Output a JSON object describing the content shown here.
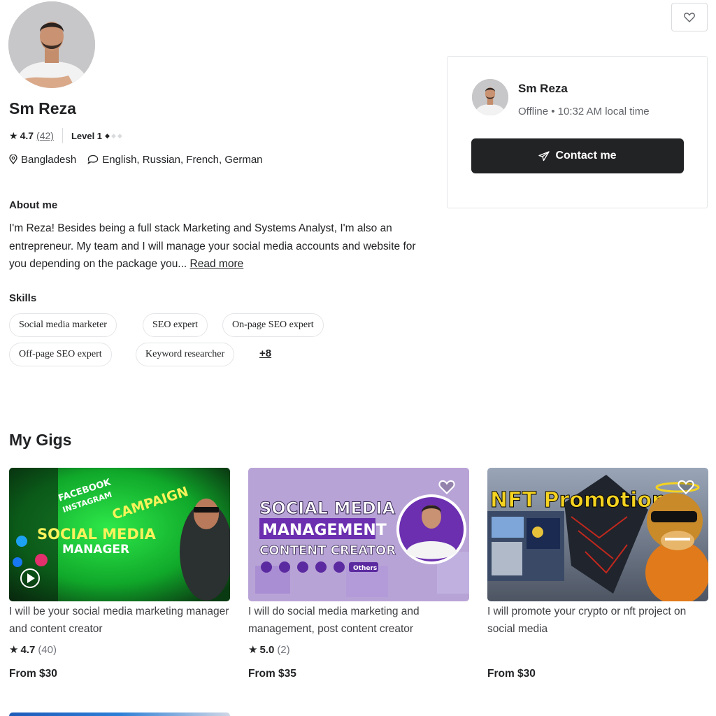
{
  "profile": {
    "name": "Sm Reza",
    "rating": "4.7",
    "review_count": "(42)",
    "level": "Level 1",
    "country": "Bangladesh",
    "languages": "English, Russian, French, German"
  },
  "about": {
    "heading": "About me",
    "text": "I'm Reza! Besides being a full stack Marketing and Systems Analyst, I'm also an entrepreneur. My team and I will manage your social media accounts and website for you depending on the package you...",
    "read_more": "Read more"
  },
  "skills": {
    "heading": "Skills",
    "items": [
      "Social media marketer",
      "SEO expert",
      "On-page SEO expert",
      "Off-page SEO expert",
      "Keyword researcher"
    ],
    "more": "+8"
  },
  "contact_card": {
    "name": "Sm Reza",
    "status": "Offline • 10:32 AM local time",
    "button": "Contact me"
  },
  "gigs": {
    "heading": "My Gigs",
    "items": [
      {
        "title": "I will be your social media marketing manager and content creator",
        "rating": "4.7",
        "count": "(40)",
        "price": "From $30",
        "thumb_lines": [
          "FACEBOOK",
          "INSTAGRAM",
          "CAMPAIGN",
          "SOCIAL MEDIA",
          "MANAGER"
        ]
      },
      {
        "title": "I will do social media marketing and management, post content creator",
        "rating": "5.0",
        "count": "(2)",
        "price": "From $35",
        "thumb_lines": [
          "SOCIAL MEDIA",
          "MANAGEMENT",
          "CONTENT CREATOR",
          "Others"
        ]
      },
      {
        "title": "I will promote your crypto or nft project on social media",
        "rating": "",
        "count": "",
        "price": "From $30",
        "thumb_lines": [
          "NFT Promotion"
        ]
      }
    ]
  },
  "icons": {
    "favorite": "heart-icon",
    "location": "location-pin-icon",
    "language": "chat-bubble-icon",
    "send": "paper-plane-icon",
    "play": "play-icon",
    "star": "star-icon"
  },
  "colors": {
    "primary_dark": "#222325",
    "muted": "#62646a",
    "border": "#e4e5e7"
  }
}
